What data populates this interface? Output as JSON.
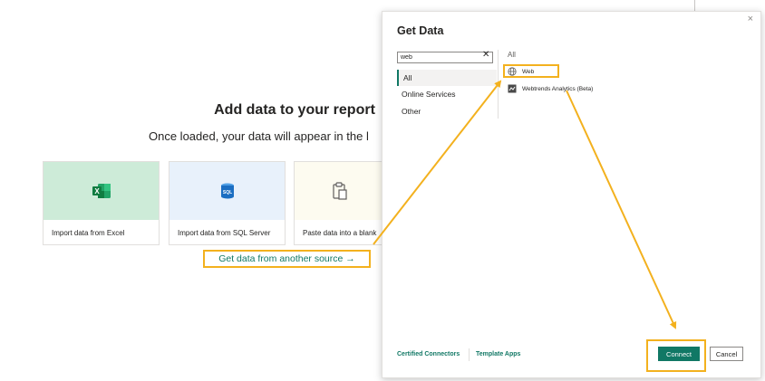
{
  "canvas": {
    "title": "Add data to your report",
    "subtitle": "Once loaded, your data will appear in the",
    "subtitle_tail": "l",
    "cards": [
      {
        "label": "Import data from Excel",
        "icon": "excel-icon"
      },
      {
        "label": "Import data from SQL Server",
        "icon": "sql-server-icon"
      },
      {
        "label": "Paste data into a blank",
        "icon": "paste-icon"
      }
    ],
    "get_more_link": "Get data from another source →",
    "sql_icon_text": "SQL",
    "excel_icon_text": "X"
  },
  "dialog": {
    "title": "Get Data",
    "close_glyph": "×",
    "search_value": "web",
    "clear_glyph": "✕",
    "categories": [
      {
        "label": "All",
        "selected": true
      },
      {
        "label": "Online Services",
        "selected": false
      },
      {
        "label": "Other",
        "selected": false
      }
    ],
    "results_header": "All",
    "connectors": [
      {
        "label": "Web",
        "icon": "globe-icon"
      },
      {
        "label": "Webtrends Analytics (Beta)",
        "icon": "webtrends-icon"
      }
    ],
    "footer_links": [
      "Certified Connectors",
      "Template Apps"
    ],
    "connect_label": "Connect",
    "cancel_label": "Cancel"
  },
  "colors": {
    "accent": "#117865",
    "highlight": "#f3b11e",
    "excel_bg": "#cdebd8",
    "sql_bg": "#e8f1fb",
    "paste_bg": "#fdfbf0"
  }
}
